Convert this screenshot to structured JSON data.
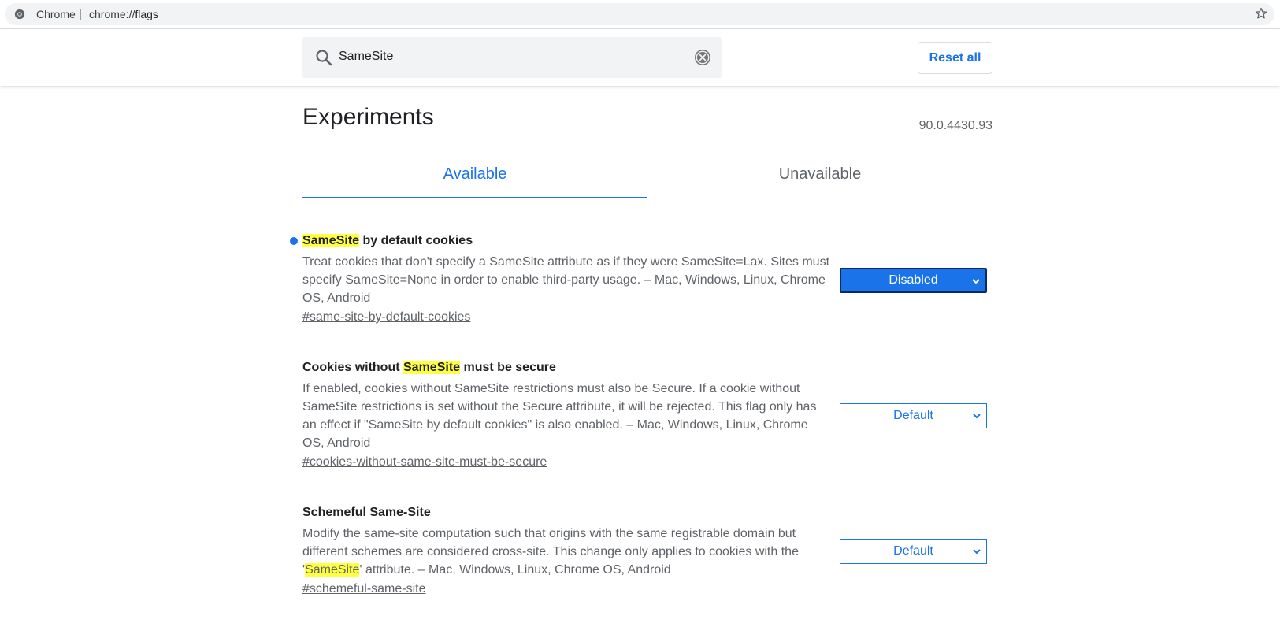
{
  "browser": {
    "site_name": "Chrome",
    "url_scheme": "chrome://",
    "url_path": "flags"
  },
  "header": {
    "search_value": "SameSite",
    "reset_label": "Reset all"
  },
  "page": {
    "title": "Experiments",
    "version": "90.0.4430.93",
    "tabs": [
      {
        "label": "Available",
        "selected": true
      },
      {
        "label": "Unavailable",
        "selected": false
      }
    ]
  },
  "experiments": [
    {
      "title_pre": "",
      "title_hl": "SameSite",
      "title_post": " by default cookies",
      "desc_pre": "Treat cookies that don't specify a SameSite attribute as if they were SameSite=Lax. Sites must specify SameSite=None in order to enable third-party usage. – Mac, Windows, Linux, Chrome OS, Android",
      "desc_hl": "",
      "desc_post": "",
      "link": "#same-site-by-default-cookies",
      "value": "Disabled",
      "modified": true
    },
    {
      "title_pre": "Cookies without ",
      "title_hl": "SameSite",
      "title_post": " must be secure",
      "desc_pre": "If enabled, cookies without SameSite restrictions must also be Secure. If a cookie without SameSite restrictions is set without the Secure attribute, it will be rejected. This flag only has an effect if \"SameSite by default cookies\" is also enabled. – Mac, Windows, Linux, Chrome OS, Android",
      "desc_hl": "",
      "desc_post": "",
      "link": "#cookies-without-same-site-must-be-secure",
      "value": "Default",
      "modified": false
    },
    {
      "title_pre": "Schemeful Same-Site",
      "title_hl": "",
      "title_post": "",
      "desc_pre": "Modify the same-site computation such that origins with the same registrable domain but different schemes are considered cross-site. This change only applies to cookies with the '",
      "desc_hl": "SameSite",
      "desc_post": "' attribute. – Mac, Windows, Linux, Chrome OS, Android",
      "link": "#schemeful-same-site",
      "value": "Default",
      "modified": false
    }
  ],
  "colors": {
    "accent": "#1a73e8",
    "highlight": "#ffff44",
    "modified_dot": "#1a73e8"
  },
  "icons": {
    "site": "chrome-logo-icon",
    "bookmark": "star-icon",
    "search": "search-icon",
    "clear": "clear-icon",
    "dropdown": "chevron-down-icon"
  }
}
